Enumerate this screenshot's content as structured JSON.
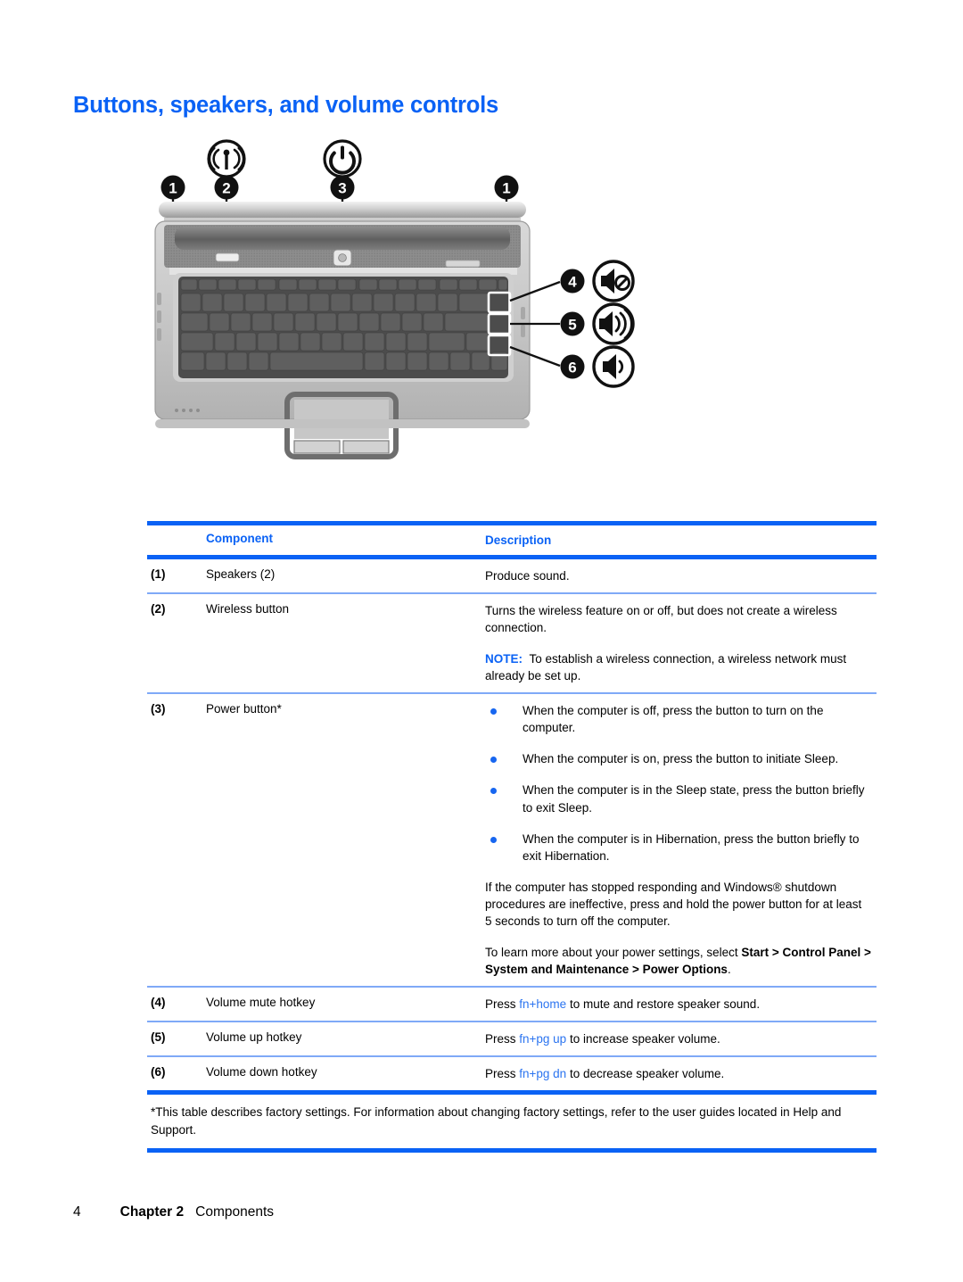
{
  "document": {
    "title": "Buttons, speakers, and volume controls"
  },
  "figure": {
    "alt_name": "laptop-top-view-diagram",
    "callouts": [
      {
        "id": "1",
        "label": "1",
        "position": "top-left",
        "icon": "speaker-grille-icon"
      },
      {
        "id": "2",
        "label": "2",
        "position": "top-left",
        "icon": "wireless-antenna-icon"
      },
      {
        "id": "3",
        "label": "3",
        "position": "top-center",
        "icon": "power-button-icon"
      },
      {
        "id": "1b",
        "label": "1",
        "position": "top-right",
        "icon": "speaker-grille-icon"
      },
      {
        "id": "4",
        "label": "4",
        "position": "right",
        "icon": "volume-mute-icon"
      },
      {
        "id": "5",
        "label": "5",
        "position": "right",
        "icon": "volume-up-icon"
      },
      {
        "id": "6",
        "label": "6",
        "position": "right",
        "icon": "volume-down-icon"
      }
    ]
  },
  "table": {
    "headers": {
      "number": "",
      "component": "Component",
      "description": "Description"
    },
    "rows": [
      {
        "num": "(1)",
        "component": "Speakers (2)",
        "desc_simple": "Produce sound."
      },
      {
        "num": "(2)",
        "component": "Wireless button",
        "desc_p1": "Turns the wireless feature on or off, but does not create a wireless connection.",
        "note_label": "NOTE:",
        "note_text": "To establish a wireless connection, a wireless network must already be set up."
      },
      {
        "num": "(3)",
        "component": "Power button*",
        "bullets": [
          "When the computer is off, press the button to turn on the computer.",
          "When the computer is on, press the button to initiate Sleep.",
          "When the computer is in the Sleep state, press the button briefly to exit Sleep.",
          "When the computer is in Hibernation, press the button briefly to exit Hibernation."
        ],
        "para_after": "If the computer has stopped responding and Windows® shutdown procedures are ineffective, press and hold the power button for at least 5 seconds to turn off the computer.",
        "para_last_lead": "To learn more about your power settings, select ",
        "para_last_bold": "Start > Control Panel > System and Maintenance > Power Options",
        "para_last_end": "."
      },
      {
        "num": "(4)",
        "component": "Volume mute hotkey",
        "desc_lead": "Press ",
        "desc_key": "fn+home",
        "desc_tail": " to mute and restore speaker sound."
      },
      {
        "num": "(5)",
        "component": "Volume up hotkey",
        "desc_lead": "Press ",
        "desc_key": "fn+pg up",
        "desc_tail": " to increase speaker volume."
      },
      {
        "num": "(6)",
        "component": "Volume down hotkey",
        "desc_lead": "Press ",
        "desc_key": "fn+pg dn",
        "desc_tail": " to decrease speaker volume."
      }
    ],
    "footnote": "*This table describes factory settings. For information about changing factory settings, refer to the user guides located in Help and Support."
  },
  "footer": {
    "page_number": "4",
    "chapter": "Chapter 2",
    "section": "Components"
  },
  "colors": {
    "accent_blue": "#0A62F5",
    "rule_light_blue": "#7FA9F7",
    "key_blue": "#2B74F0"
  }
}
